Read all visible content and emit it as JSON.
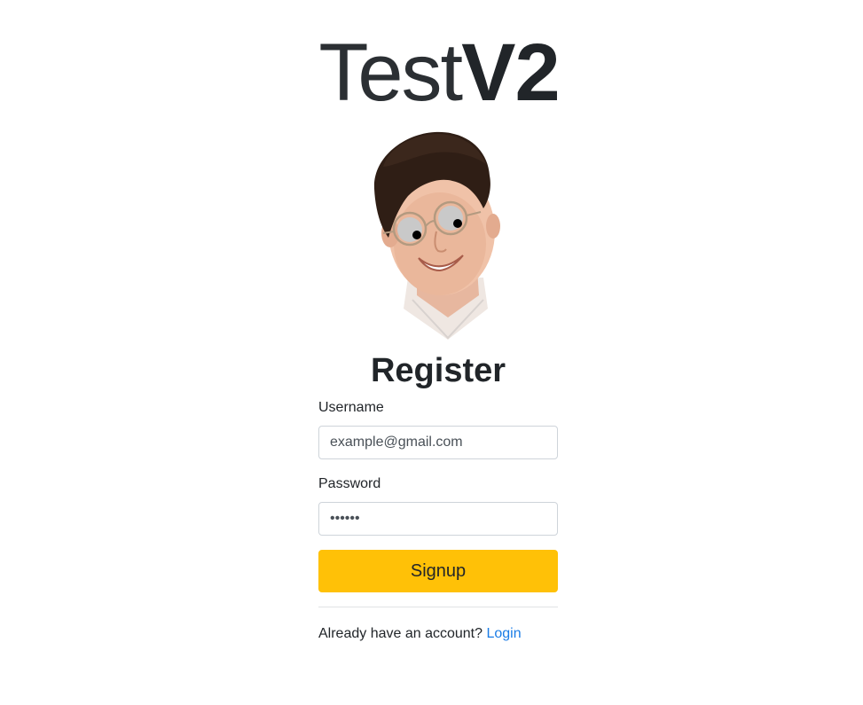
{
  "brand": {
    "light": "Test",
    "bold": "V2"
  },
  "avatar": {
    "icon": "person-with-googly-eyes-icon"
  },
  "register": {
    "heading": "Register",
    "username_label": "Username",
    "username_value": "example@gmail.com",
    "password_label": "Password",
    "password_value": "••••••",
    "signup_label": "Signup"
  },
  "footer": {
    "prompt": "Already have an account?",
    "login_label": "Login"
  },
  "colors": {
    "signup": "#ffc107",
    "link": "#1a7ce6",
    "text": "#212529"
  }
}
